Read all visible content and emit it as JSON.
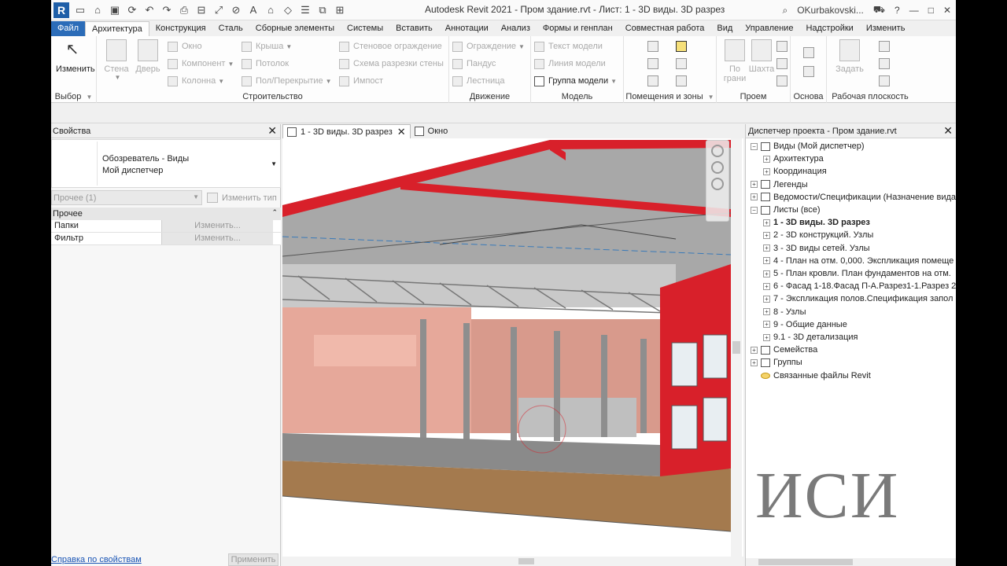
{
  "app": {
    "title": "Autodesk Revit 2021 - Пром здание.rvt - Лист: 1 - 3D виды. 3D разрез",
    "user": "OKurbakovski...",
    "help": "?",
    "logo_letter": "R"
  },
  "ribbon_tabs": [
    "Файл",
    "Архитектура",
    "Конструкция",
    "Сталь",
    "Сборные элементы",
    "Системы",
    "Вставить",
    "Аннотации",
    "Анализ",
    "Формы и генплан",
    "Совместная работа",
    "Вид",
    "Управление",
    "Надстройки",
    "Изменить"
  ],
  "ribbon": {
    "modify_label": "Изменить",
    "select_panel": "Выбор",
    "wall": "Стена",
    "door": "Дверь",
    "window": "Окно",
    "component": "Компонент",
    "column": "Колонна",
    "roof": "Крыша",
    "ceiling": "Потолок",
    "floor": "Пол/Перекрытие",
    "curtain_wall": "Стеновое ограждение",
    "curtain_grid": "Схема разрезки стены",
    "mullion": "Импост",
    "build_panel": "Строительство",
    "railing": "Ограждение",
    "ramp": "Пандус",
    "stair": "Лестница",
    "circulation_panel": "Движение",
    "model_text": "Текст модели",
    "model_line": "Линия  модели",
    "model_group": "Группа модели",
    "model_panel": "Модель",
    "rooms_panel": "Помещения и зоны",
    "by_face": "По грани",
    "shaft": "Шахта",
    "opening_panel": "Проем",
    "datum_panel": "Основа",
    "set": "Задать",
    "workplane_panel": "Рабочая плоскость"
  },
  "properties": {
    "title": "Свойства",
    "type_line1": "Обозреватель - Виды",
    "type_line2": "Мой диспетчер",
    "filter": "Прочее (1)",
    "edit_type": "Изменить тип",
    "group": "Прочее",
    "rows": [
      {
        "name": "Папки",
        "value": "Изменить..."
      },
      {
        "name": "Фильтр",
        "value": "Изменить..."
      }
    ],
    "help_link": "Справка по свойствам",
    "apply": "Применить"
  },
  "view_tabs": [
    {
      "label": "1 - 3D виды. 3D разрез"
    },
    {
      "label": "Окно"
    }
  ],
  "browser": {
    "title": "Диспетчер проекта - Пром здание.rvt",
    "nodes": [
      {
        "label": "Виды (Мой диспетчер)",
        "level": 0,
        "exp": "−"
      },
      {
        "label": "Архитектура",
        "level": 1,
        "exp": "+"
      },
      {
        "label": "Координация",
        "level": 1,
        "exp": "+"
      },
      {
        "label": "Легенды",
        "level": 0,
        "exp": "+"
      },
      {
        "label": "Ведомости/Спецификации (Назначение вида",
        "level": 0,
        "exp": "+"
      },
      {
        "label": "Листы (все)",
        "level": 0,
        "exp": "−"
      },
      {
        "label": "1 - 3D виды. 3D разрез",
        "level": 1,
        "exp": "+",
        "bold": true
      },
      {
        "label": "2 - 3D конструкций. Узлы",
        "level": 1,
        "exp": "+"
      },
      {
        "label": "3 - 3D виды сетей. Узлы",
        "level": 1,
        "exp": "+"
      },
      {
        "label": "4 - План на отм. 0,000. Экспликация помеще",
        "level": 1,
        "exp": "+"
      },
      {
        "label": "5 - План кровли.  План фундаментов на отм.",
        "level": 1,
        "exp": "+"
      },
      {
        "label": "6 - Фасад 1-18.Фасад П-А.Разрез1-1.Разрез 2",
        "level": 1,
        "exp": "+"
      },
      {
        "label": "7 - Экспликация полов.Спецификация запол",
        "level": 1,
        "exp": "+"
      },
      {
        "label": "8 - Узлы",
        "level": 1,
        "exp": "+"
      },
      {
        "label": "9 - Общие данные",
        "level": 1,
        "exp": "+"
      },
      {
        "label": "9.1 - 3D детализация",
        "level": 1,
        "exp": "+"
      },
      {
        "label": "Семейства",
        "level": 0,
        "exp": "+"
      },
      {
        "label": "Группы",
        "level": 0,
        "exp": "+"
      },
      {
        "label": "Связанные файлы Revit",
        "level": 0,
        "exp": ""
      }
    ]
  },
  "watermark": "ИСИ",
  "colors": {
    "accent": "#2b6cb8",
    "facade_red": "#d8202a",
    "wall_pink": "#e6a89a"
  }
}
